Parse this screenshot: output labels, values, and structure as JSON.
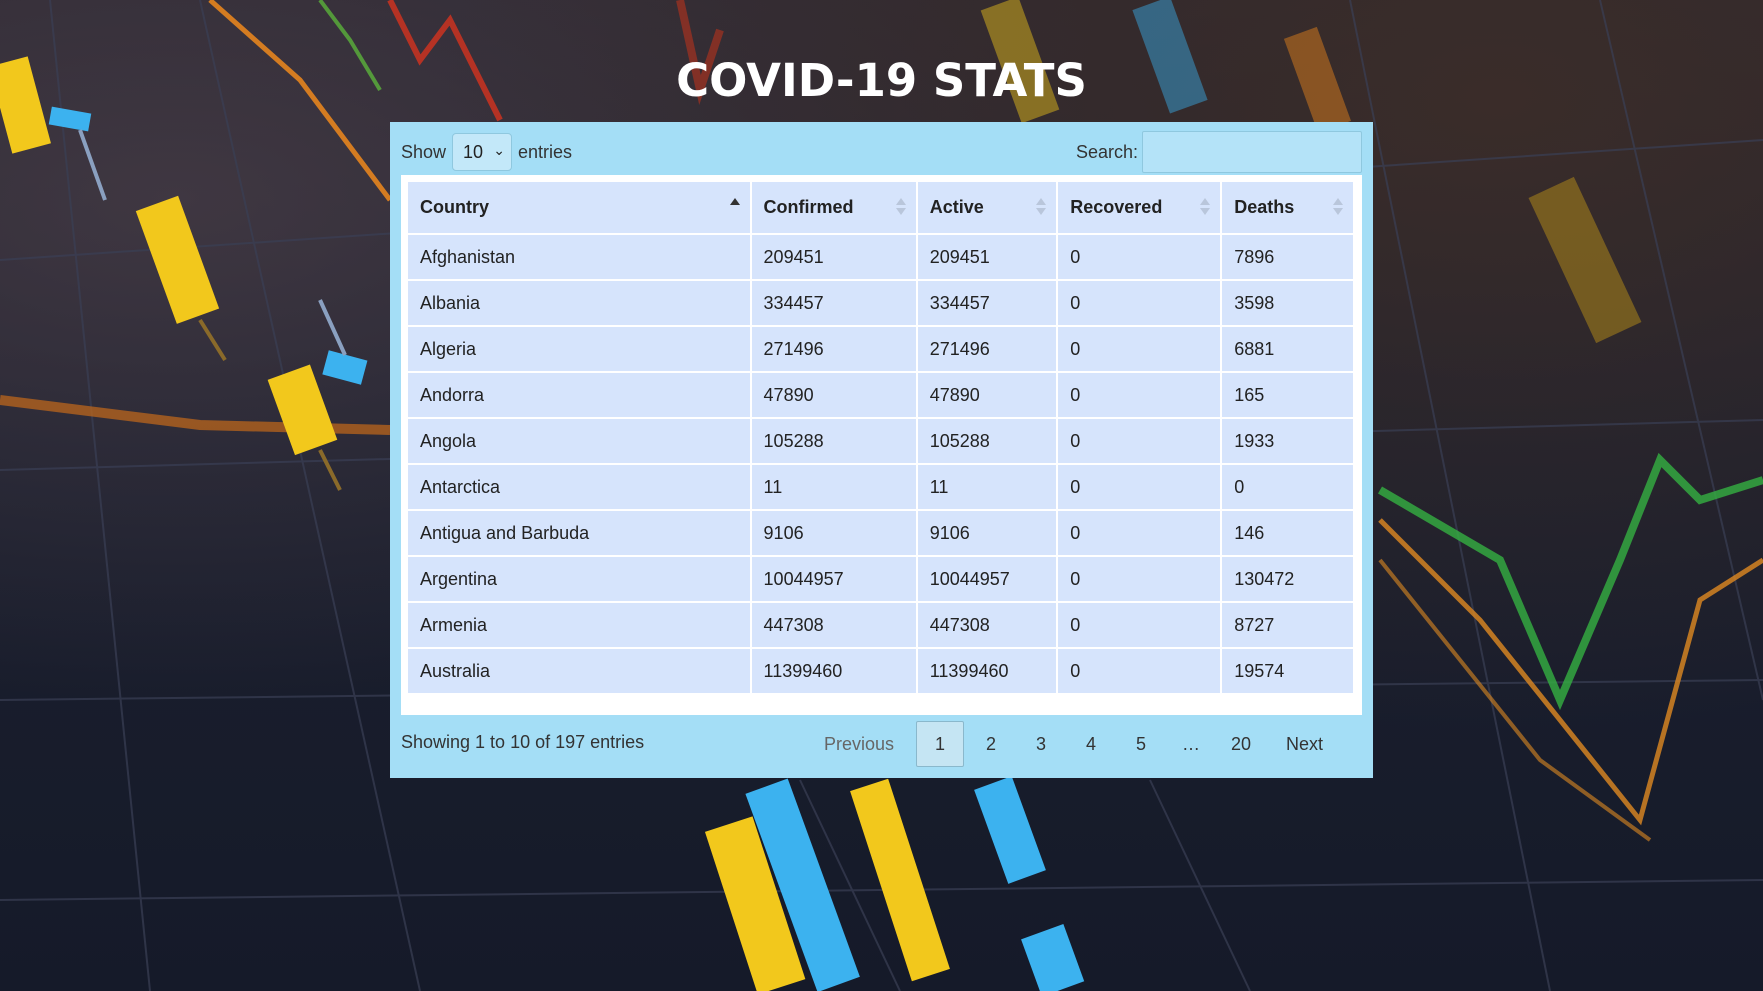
{
  "page": {
    "title": "COVID-19 STATS"
  },
  "length_control": {
    "label_before": "Show",
    "selected": "10",
    "label_after": "entries"
  },
  "search": {
    "label": "Search:",
    "value": "",
    "placeholder": ""
  },
  "table": {
    "columns": [
      {
        "label": "Country",
        "sort": "asc"
      },
      {
        "label": "Confirmed",
        "sort": "none"
      },
      {
        "label": "Active",
        "sort": "none"
      },
      {
        "label": "Recovered",
        "sort": "none"
      },
      {
        "label": "Deaths",
        "sort": "none"
      }
    ],
    "rows": [
      [
        "Afghanistan",
        "209451",
        "209451",
        "0",
        "7896"
      ],
      [
        "Albania",
        "334457",
        "334457",
        "0",
        "3598"
      ],
      [
        "Algeria",
        "271496",
        "271496",
        "0",
        "6881"
      ],
      [
        "Andorra",
        "47890",
        "47890",
        "0",
        "165"
      ],
      [
        "Angola",
        "105288",
        "105288",
        "0",
        "1933"
      ],
      [
        "Antarctica",
        "11",
        "11",
        "0",
        "0"
      ],
      [
        "Antigua and Barbuda",
        "9106",
        "9106",
        "0",
        "146"
      ],
      [
        "Argentina",
        "10044957",
        "10044957",
        "0",
        "130472"
      ],
      [
        "Armenia",
        "447308",
        "447308",
        "0",
        "8727"
      ],
      [
        "Australia",
        "11399460",
        "11399460",
        "0",
        "19574"
      ]
    ]
  },
  "info": {
    "text": "Showing 1 to 10 of 197 entries"
  },
  "pagination": {
    "previous": "Previous",
    "pages": [
      "1",
      "2",
      "3",
      "4",
      "5"
    ],
    "current": "1",
    "ellipsis": "…",
    "last": "20",
    "next": "Next"
  },
  "colors": {
    "panel": "#a4def6",
    "cell": "#d6e4fc",
    "title": "#ffffff"
  }
}
